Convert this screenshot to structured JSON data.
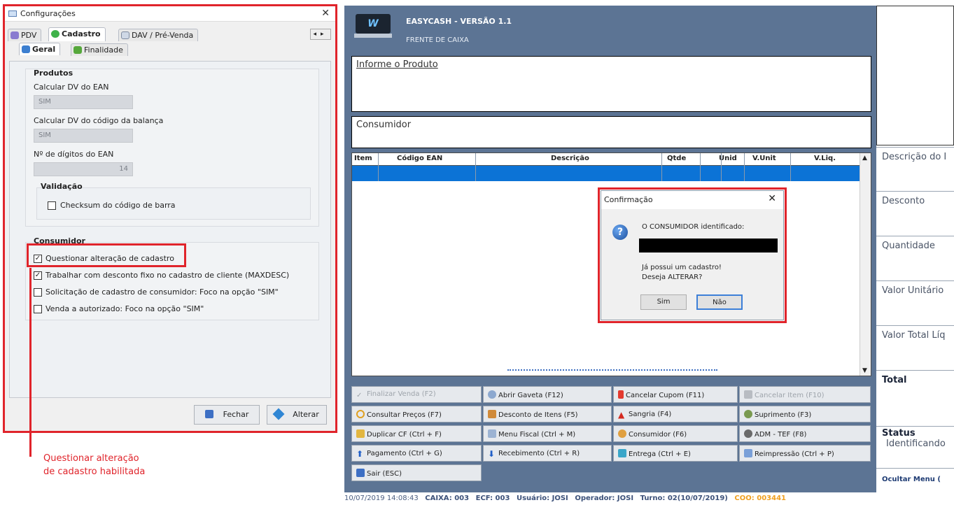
{
  "config_window": {
    "title": "Configurações",
    "close": "✕",
    "tabs": [
      "PDV",
      "Cadastro",
      "DAV / Pré-Venda"
    ],
    "active_tab": "Cadastro",
    "subtabs": [
      "Geral",
      "Finalidade"
    ],
    "active_subtab": "Geral",
    "produtos": {
      "title": "Produtos",
      "calc_dv_ean_label": "Calcular DV do EAN",
      "calc_dv_ean_value": "SIM",
      "calc_dv_balanca_label": "Calcular DV do código da balança",
      "calc_dv_balanca_value": "SIM",
      "num_digitos_label": "Nº de dígitos do EAN",
      "num_digitos_value": "14",
      "validacao_title": "Validação",
      "checksum_label": "Checksum do código de barra",
      "checksum_checked": false
    },
    "consumidor": {
      "title": "Consumidor",
      "options": [
        {
          "label": "Questionar alteração de cadastro",
          "checked": true
        },
        {
          "label": "Trabalhar com desconto fixo no cadastro de cliente (MAXDESC)",
          "checked": true
        },
        {
          "label": "Solicitação de cadastro de consumidor: Foco na opção \"SIM\"",
          "checked": false
        },
        {
          "label": "Venda a autorizado: Foco na opção \"SIM\"",
          "checked": false
        }
      ]
    },
    "buttons": {
      "fechar": "Fechar",
      "alterar": "Alterar"
    }
  },
  "annotation": {
    "line1": "Questionar alteração",
    "line2": "de cadastro habilitada",
    "color": "#e0242b"
  },
  "pos": {
    "title": "EASYCASH - VERSÃO 1.1",
    "subtitle": "FRENTE DE CAIXA",
    "logo": "W",
    "informe_produto": "Informe o Produto",
    "consumidor": "Consumidor",
    "grid_columns": [
      "Item",
      "Código EAN",
      "Descrição",
      "Qtde",
      "Unid",
      "V.Unit",
      "V.Liq."
    ],
    "function_buttons": [
      [
        {
          "label": "Finalizar Venda (F2)",
          "disabled": true,
          "icon": "check-icon"
        },
        {
          "label": "Abrir Gaveta (F12)",
          "icon": "drawer-icon"
        },
        {
          "label": "Cancelar Cupom (F11)",
          "icon": "flag-icon"
        },
        {
          "label": "Cancelar Item (F10)",
          "disabled": true,
          "icon": "minus-icon"
        }
      ],
      [
        {
          "label": "Consultar Preços (F7)",
          "icon": "search-icon"
        },
        {
          "label": "Desconto de Itens (F5)",
          "icon": "discount-icon"
        },
        {
          "label": "Sangria (F4)",
          "icon": "warning-icon"
        },
        {
          "label": "Suprimento (F3)",
          "icon": "money-bag-icon"
        }
      ],
      [
        {
          "label": "Duplicar CF (Ctrl + F)",
          "icon": "duplicate-icon"
        },
        {
          "label": "Menu Fiscal (Ctrl + M)",
          "icon": "document-icon"
        },
        {
          "label": "Consumidor (F6)",
          "icon": "users-icon"
        },
        {
          "label": "ADM - TEF (F8)",
          "icon": "admin-icon"
        }
      ],
      [
        {
          "label": "Pagamento (Ctrl + G)",
          "icon": "arrow-up-icon"
        },
        {
          "label": "Recebimento (Ctrl + R)",
          "icon": "arrow-down-icon"
        },
        {
          "label": "Entrega (Ctrl + E)",
          "icon": "monitor-icon"
        },
        {
          "label": "Reimpressão (Ctrl + P)",
          "icon": "printer-icon"
        }
      ],
      [
        {
          "label": "Sair (ESC)",
          "icon": "exit-icon"
        }
      ]
    ],
    "right_panel": {
      "descricao": "Descrição do I",
      "desconto": "Desconto",
      "quantidade": "Quantidade",
      "valor_unitario": "Valor Unitário",
      "valor_total": "Valor Total Líq",
      "total": "Total",
      "status": "Status",
      "status_value": "Identificando",
      "ocultar_menu": "Ocultar Menu ("
    },
    "status_bar": {
      "datetime": "10/07/2019 14:08:43",
      "caixa": "CAIXA: 003",
      "ecf": "ECF: 003",
      "usuario": "Usuário: JOSI",
      "operador": "Operador: JOSI",
      "turno": "Turno: 02(10/07/2019)",
      "coo": "COO: 003441",
      "coo_color": "#f0a020"
    }
  },
  "dialog": {
    "title": "Confirmação",
    "close": "✕",
    "message1": "O CONSUMIDOR identificado:",
    "message2": "Já possui um cadastro!",
    "message3": "Deseja ALTERAR?",
    "btn_sim": "Sim",
    "btn_nao": "Não",
    "icon": "?"
  }
}
